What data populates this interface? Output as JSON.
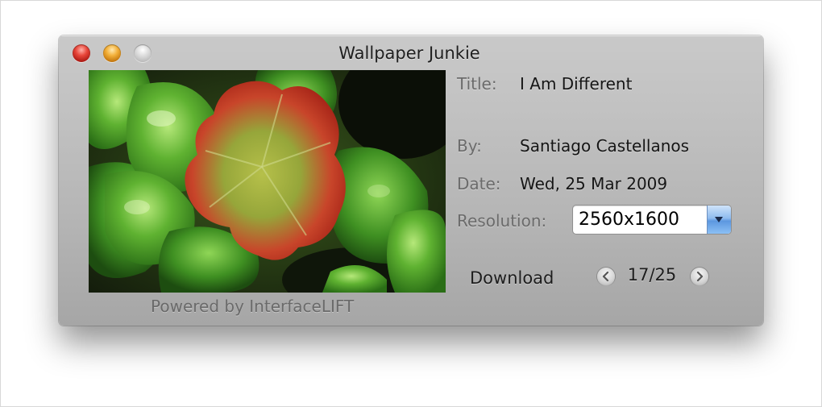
{
  "window": {
    "title": "Wallpaper Junkie"
  },
  "preview": {
    "icon": "wallpaper-thumbnail-image"
  },
  "footer": {
    "powered_by": "Powered by InterfaceLIFT"
  },
  "details": {
    "title_label": "Title:",
    "title_value": "I Am Different",
    "by_label": "By:",
    "by_value": "Santiago Castellanos",
    "date_label": "Date:",
    "date_value": "Wed, 25 Mar 2009",
    "resolution_label": "Resolution:",
    "resolution_value": "2560x1600"
  },
  "actions": {
    "download_label": "Download",
    "page_indicator": "17/25",
    "prev_icon": "chevron-left-icon",
    "next_icon": "chevron-right-icon"
  },
  "colors": {
    "close_button": "#e8463a",
    "minimize_button": "#f3b03a",
    "zoom_button": "#c8c8c8",
    "select_arrow": "#5c97df"
  }
}
